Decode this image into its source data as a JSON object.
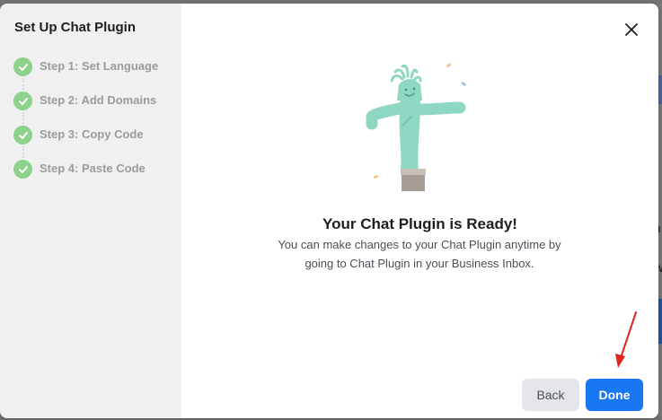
{
  "dialog": {
    "sidebar": {
      "title": "Set Up Chat Plugin",
      "steps": [
        {
          "label": "Step 1: Set Language",
          "status": "complete"
        },
        {
          "label": "Step 2: Add Domains",
          "status": "complete"
        },
        {
          "label": "Step 3: Copy Code",
          "status": "complete"
        },
        {
          "label": "Step 4: Paste Code",
          "status": "complete"
        }
      ]
    },
    "main": {
      "close_icon": "close-icon",
      "illustration": "inflatable-tube-man-illustration",
      "heading": "Your Chat Plugin is Ready!",
      "description": "You can make changes to your Chat Plugin anytime by going to Chat Plugin in your Business Inbox.",
      "back_label": "Back",
      "done_label": "Done"
    }
  },
  "background": {
    "partial_chars": [
      "n",
      "w"
    ]
  },
  "colors": {
    "primary": "#1877f2",
    "check_green": "#8cd28a",
    "illustration_teal": "#8ed8c3",
    "annotation_red": "#e0231c"
  }
}
